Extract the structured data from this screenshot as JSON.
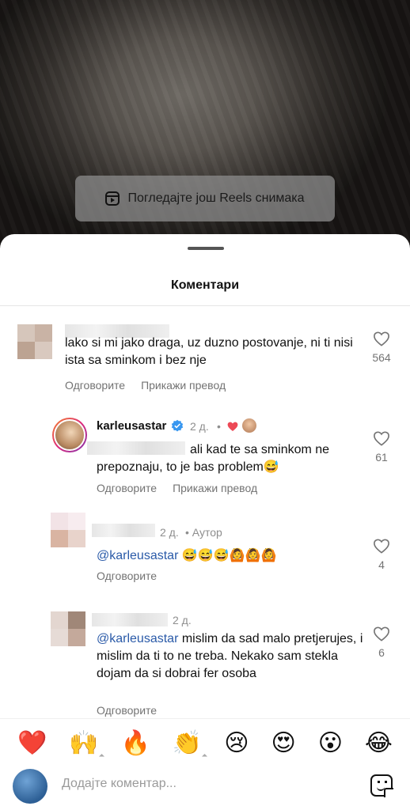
{
  "reels_banner": {
    "label": "Погледајте још Reels снимака"
  },
  "sheet": {
    "title": "Коментари"
  },
  "comments": [
    {
      "text": "lako si mi jako draga, uz duzno postovanje, ni ti nisi ista sa sminkom i bez nje",
      "likes": "564",
      "reply_label": "Одговорите",
      "translate_label": "Прикажи превод"
    },
    {
      "username": "karleusastar",
      "time": "2 д.",
      "dot": "•",
      "text": "ali kad te sa sminkom ne prepoznaju, to je bas problem😅",
      "likes": "61",
      "reply_label": "Одговорите",
      "translate_label": "Прикажи превод"
    },
    {
      "time": "2 д.",
      "author_badge": "• Аутор",
      "mention": "@karleusastar",
      "text": "😅😅😅🙆🙆🙆",
      "likes": "4",
      "reply_label": "Одговорите"
    },
    {
      "time": "2 д.",
      "mention": "@karleusastar",
      "text": "mislim da sad malo pretjerujes, i mislim da ti to ne treba. Nekako sam stekla dojam da si dobrai fer osoba",
      "likes": "6",
      "reply_label": "Одговорите"
    }
  ],
  "reactions": [
    "❤️",
    "🙌",
    "🔥",
    "👏",
    "😢",
    "😍",
    "😮",
    "😂"
  ],
  "composer": {
    "placeholder": "Додајте коментар..."
  },
  "colors": {
    "mention": "#2a5aa8",
    "verified": "#3897f0",
    "heart_red": "#ed4956"
  }
}
